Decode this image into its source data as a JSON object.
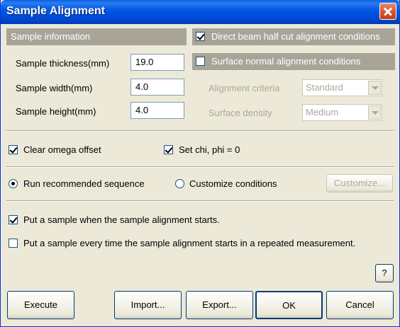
{
  "window": {
    "title": "Sample Alignment"
  },
  "sample_info": {
    "header": "Sample information",
    "thickness_label": "Sample thickness(mm)",
    "thickness_value": "19.0",
    "width_label": "Sample width(mm)",
    "width_value": "4.0",
    "height_label": "Sample height(mm)",
    "height_value": "4.0"
  },
  "alignment": {
    "direct_beam_label": "Direct beam half cut alignment conditions",
    "direct_beam_checked": true,
    "surface_normal_label": "Surface normal alignment conditions",
    "surface_normal_checked": false,
    "criteria_label": "Alignment criteria",
    "criteria_value": "Standard",
    "density_label": "Surface density",
    "density_value": "Medium"
  },
  "offsets": {
    "clear_omega_label": "Clear omega offset",
    "clear_omega_checked": true,
    "set_chi_label": "Set chi, phi = 0",
    "set_chi_checked": true
  },
  "sequence": {
    "run_recommended_label": "Run recommended sequence",
    "customize_conditions_label": "Customize conditions",
    "selected": "run_recommended",
    "customize_button": "Customize..."
  },
  "sample_put": {
    "put_on_start_label": "Put a sample when the sample alignment starts.",
    "put_on_start_checked": true,
    "put_every_time_label": "Put a sample every time the sample alignment starts in a repeated measurement.",
    "put_every_time_checked": false
  },
  "help_button": "?",
  "footer": {
    "execute": "Execute",
    "import": "Import...",
    "export": "Export...",
    "ok": "OK",
    "cancel": "Cancel"
  }
}
